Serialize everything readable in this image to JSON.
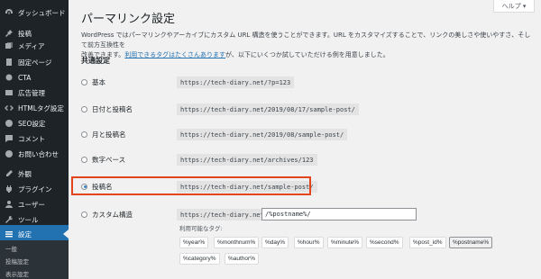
{
  "sidebar": {
    "items": [
      {
        "label": "ダッシュボード",
        "icon": "dashboard-icon"
      },
      {
        "label": "投稿",
        "icon": "pin-icon"
      },
      {
        "label": "メディア",
        "icon": "media-icon"
      },
      {
        "label": "固定ページ",
        "icon": "page-icon"
      },
      {
        "label": "CTA",
        "icon": "cta-icon"
      },
      {
        "label": "広告管理",
        "icon": "ad-icon"
      },
      {
        "label": "HTMLタグ設定",
        "icon": "code-icon"
      },
      {
        "label": "SEO設定",
        "icon": "seo-icon"
      },
      {
        "label": "コメント",
        "icon": "comment-icon"
      },
      {
        "label": "お問い合わせ",
        "icon": "mail-icon"
      },
      {
        "label": "外観",
        "icon": "appearance-icon"
      },
      {
        "label": "プラグイン",
        "icon": "plugin-icon"
      },
      {
        "label": "ユーザー",
        "icon": "user-icon"
      },
      {
        "label": "ツール",
        "icon": "tools-icon"
      },
      {
        "label": "設定",
        "icon": "settings-icon"
      }
    ],
    "submenu": [
      "一般",
      "投稿設定",
      "表示設定"
    ]
  },
  "header": {
    "title": "パーマリンク設定",
    "help_label": "ヘルプ ▾"
  },
  "description": {
    "line1": "WordPress ではパーマリンクやアーカイブにカスタム URL 構造を使うことができます。URL をカスタマイズすることで、リンクの美しさや使いやすさ、そして前方互換性を",
    "line2_prefix": "改善できます。",
    "line2_link": "利用できるタグはたくさんあります",
    "line2_suffix": "が、以下にいくつか試していただける例を用意しました。"
  },
  "section_title": "共通設定",
  "options": [
    {
      "label": "基本",
      "example": "https://tech-diary.net/?p=123",
      "checked": false
    },
    {
      "label": "日付と投稿名",
      "example": "https://tech-diary.net/2019/08/17/sample-post/",
      "checked": false
    },
    {
      "label": "月と投稿名",
      "example": "https://tech-diary.net/2019/08/sample-post/",
      "checked": false
    },
    {
      "label": "数字ベース",
      "example": "https://tech-diary.net/archives/123",
      "checked": false
    },
    {
      "label": "投稿名",
      "example": "https://tech-diary.net/sample-post/",
      "checked": true
    },
    {
      "label": "カスタム構造",
      "example": "https://tech-diary.net",
      "checked": false
    }
  ],
  "custom": {
    "value": "/%postname%/",
    "tags_label": "利用可能なタグ:",
    "tags": [
      "%year%",
      "%monthnum%",
      "%day%",
      "%hour%",
      "%minute%",
      "%second%",
      "%post_id%",
      "%postname%",
      "%category%",
      "%author%"
    ],
    "active_tag": "%postname%"
  },
  "colors": {
    "sidebar_bg": "#1d2327",
    "active_bg": "#2271b1",
    "highlight_border": "#e2451b",
    "link": "#2271b1"
  }
}
